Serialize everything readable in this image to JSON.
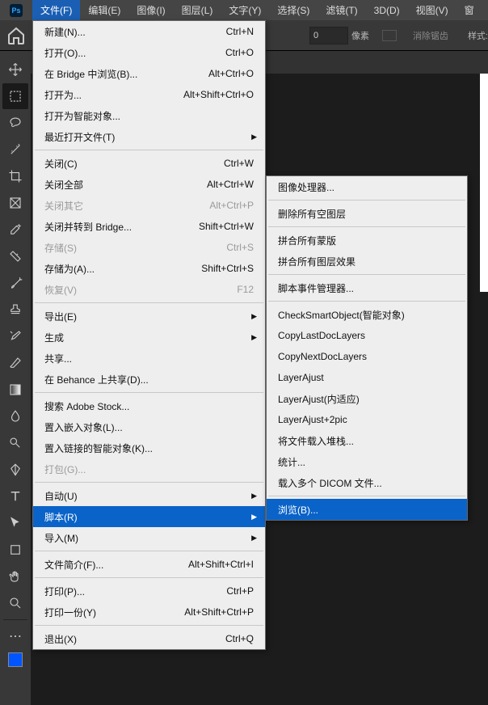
{
  "menubar": {
    "logo": "Ps",
    "items": [
      "文件(F)",
      "编辑(E)",
      "图像(I)",
      "图层(L)",
      "文字(Y)",
      "选择(S)",
      "滤镜(T)",
      "3D(D)",
      "视图(V)",
      "窗"
    ]
  },
  "optionbar": {
    "field_value": "0",
    "unit": "像素",
    "antialias": "消除锯齿",
    "style": "样式:"
  },
  "toolbar_colors": {
    "fg": "#0055ff",
    "bg": "#ffffff"
  },
  "file_menu": [
    {
      "label": "新建(N)...",
      "short": "Ctrl+N"
    },
    {
      "label": "打开(O)...",
      "short": "Ctrl+O"
    },
    {
      "label": "在 Bridge 中浏览(B)...",
      "short": "Alt+Ctrl+O"
    },
    {
      "label": "打开为...",
      "short": "Alt+Shift+Ctrl+O"
    },
    {
      "label": "打开为智能对象..."
    },
    {
      "label": "最近打开文件(T)",
      "sub": true
    },
    {
      "sep": true
    },
    {
      "label": "关闭(C)",
      "short": "Ctrl+W"
    },
    {
      "label": "关闭全部",
      "short": "Alt+Ctrl+W"
    },
    {
      "label": "关闭其它",
      "short": "Alt+Ctrl+P",
      "disabled": true
    },
    {
      "label": "关闭并转到 Bridge...",
      "short": "Shift+Ctrl+W"
    },
    {
      "label": "存储(S)",
      "short": "Ctrl+S",
      "disabled": true
    },
    {
      "label": "存储为(A)...",
      "short": "Shift+Ctrl+S"
    },
    {
      "label": "恢复(V)",
      "short": "F12",
      "disabled": true
    },
    {
      "sep": true
    },
    {
      "label": "导出(E)",
      "sub": true
    },
    {
      "label": "生成",
      "sub": true
    },
    {
      "label": "共享..."
    },
    {
      "label": "在 Behance 上共享(D)..."
    },
    {
      "sep": true
    },
    {
      "label": "搜索 Adobe Stock..."
    },
    {
      "label": "置入嵌入对象(L)..."
    },
    {
      "label": "置入链接的智能对象(K)..."
    },
    {
      "label": "打包(G)...",
      "disabled": true
    },
    {
      "sep": true
    },
    {
      "label": "自动(U)",
      "sub": true
    },
    {
      "label": "脚本(R)",
      "sub": true,
      "hl": true
    },
    {
      "label": "导入(M)",
      "sub": true
    },
    {
      "sep": true
    },
    {
      "label": "文件简介(F)...",
      "short": "Alt+Shift+Ctrl+I"
    },
    {
      "sep": true
    },
    {
      "label": "打印(P)...",
      "short": "Ctrl+P"
    },
    {
      "label": "打印一份(Y)",
      "short": "Alt+Shift+Ctrl+P"
    },
    {
      "sep": true
    },
    {
      "label": "退出(X)",
      "short": "Ctrl+Q"
    }
  ],
  "script_submenu": [
    {
      "label": "图像处理器..."
    },
    {
      "sep": true
    },
    {
      "label": "删除所有空图层"
    },
    {
      "sep": true
    },
    {
      "label": "拼合所有蒙版"
    },
    {
      "label": "拼合所有图层效果"
    },
    {
      "sep": true
    },
    {
      "label": "脚本事件管理器..."
    },
    {
      "sep": true
    },
    {
      "label": "CheckSmartObject(智能对象)"
    },
    {
      "label": "CopyLastDocLayers"
    },
    {
      "label": "CopyNextDocLayers"
    },
    {
      "label": "LayerAjust"
    },
    {
      "label": "LayerAjust(内适应)"
    },
    {
      "label": "LayerAjust+2pic"
    },
    {
      "label": "将文件载入堆栈..."
    },
    {
      "label": "统计..."
    },
    {
      "label": "载入多个 DICOM 文件..."
    },
    {
      "sep": true
    },
    {
      "label": "浏览(B)...",
      "hl": true
    }
  ]
}
